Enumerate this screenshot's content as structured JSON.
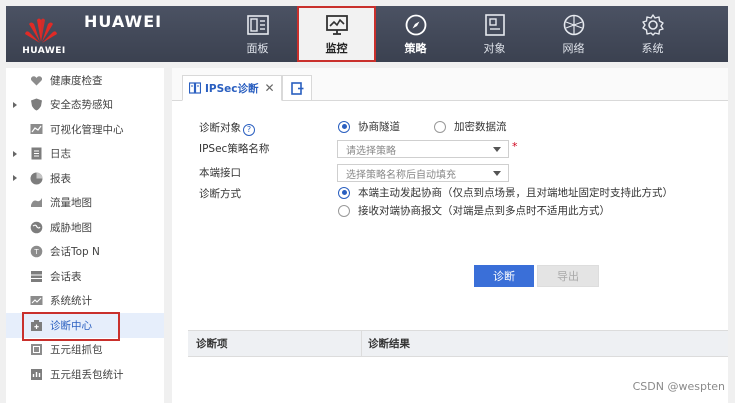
{
  "app": {
    "brand": "HUAWEI",
    "logo_text": "HUAWEI",
    "accent_color": "#c9302c",
    "primary_color": "#3a6fd8"
  },
  "nav": {
    "items": [
      {
        "label": "面板",
        "icon": "dashboard-icon"
      },
      {
        "label": "监控",
        "icon": "monitor-icon",
        "active": true
      },
      {
        "label": "策略",
        "icon": "compass-icon"
      },
      {
        "label": "对象",
        "icon": "object-icon"
      },
      {
        "label": "网络",
        "icon": "network-icon"
      },
      {
        "label": "系统",
        "icon": "gear-icon"
      }
    ]
  },
  "sidebar": {
    "items": [
      {
        "label": "健康度检查",
        "icon": "heart-icon"
      },
      {
        "label": "安全态势感知",
        "icon": "shield-icon",
        "expandable": true
      },
      {
        "label": "可视化管理中心",
        "icon": "visual-icon"
      },
      {
        "label": "日志",
        "icon": "log-icon",
        "expandable": true
      },
      {
        "label": "报表",
        "icon": "report-icon",
        "expandable": true
      },
      {
        "label": "流量地图",
        "icon": "traffic-map-icon"
      },
      {
        "label": "威胁地图",
        "icon": "threat-map-icon"
      },
      {
        "label": "会话Top N",
        "icon": "session-top-icon"
      },
      {
        "label": "会话表",
        "icon": "session-table-icon"
      },
      {
        "label": "系统统计",
        "icon": "stats-icon"
      },
      {
        "label": "诊断中心",
        "icon": "diagnose-icon",
        "active": true
      },
      {
        "label": "五元组抓包",
        "icon": "capture-icon"
      },
      {
        "label": "五元组丢包统计",
        "icon": "drop-stats-icon"
      }
    ]
  },
  "tabs": {
    "active_label": "IPSec诊断",
    "close_glyph": "✕"
  },
  "form": {
    "target_label": "诊断对象",
    "help_glyph": "?",
    "target_options": [
      {
        "label": "协商隧道",
        "checked": true
      },
      {
        "label": "加密数据流",
        "checked": false
      }
    ],
    "policy_label": "IPSec策略名称",
    "policy_placeholder": "请选择策略",
    "required_mark": "*",
    "interface_label": "本端接口",
    "interface_placeholder": "选择策略名称后自动填充",
    "method_label": "诊断方式",
    "method_options": [
      {
        "label": "本端主动发起协商（仅点到点场景，且对端地址固定时支持此方式）",
        "checked": true
      },
      {
        "label": "接收对端协商报文（对端是点到多点时不适用此方式）",
        "checked": false
      }
    ]
  },
  "actions": {
    "diagnose_label": "诊断",
    "export_label": "导出"
  },
  "results": {
    "columns": [
      "诊断项",
      "诊断结果"
    ]
  },
  "watermark": "CSDN @wespten"
}
